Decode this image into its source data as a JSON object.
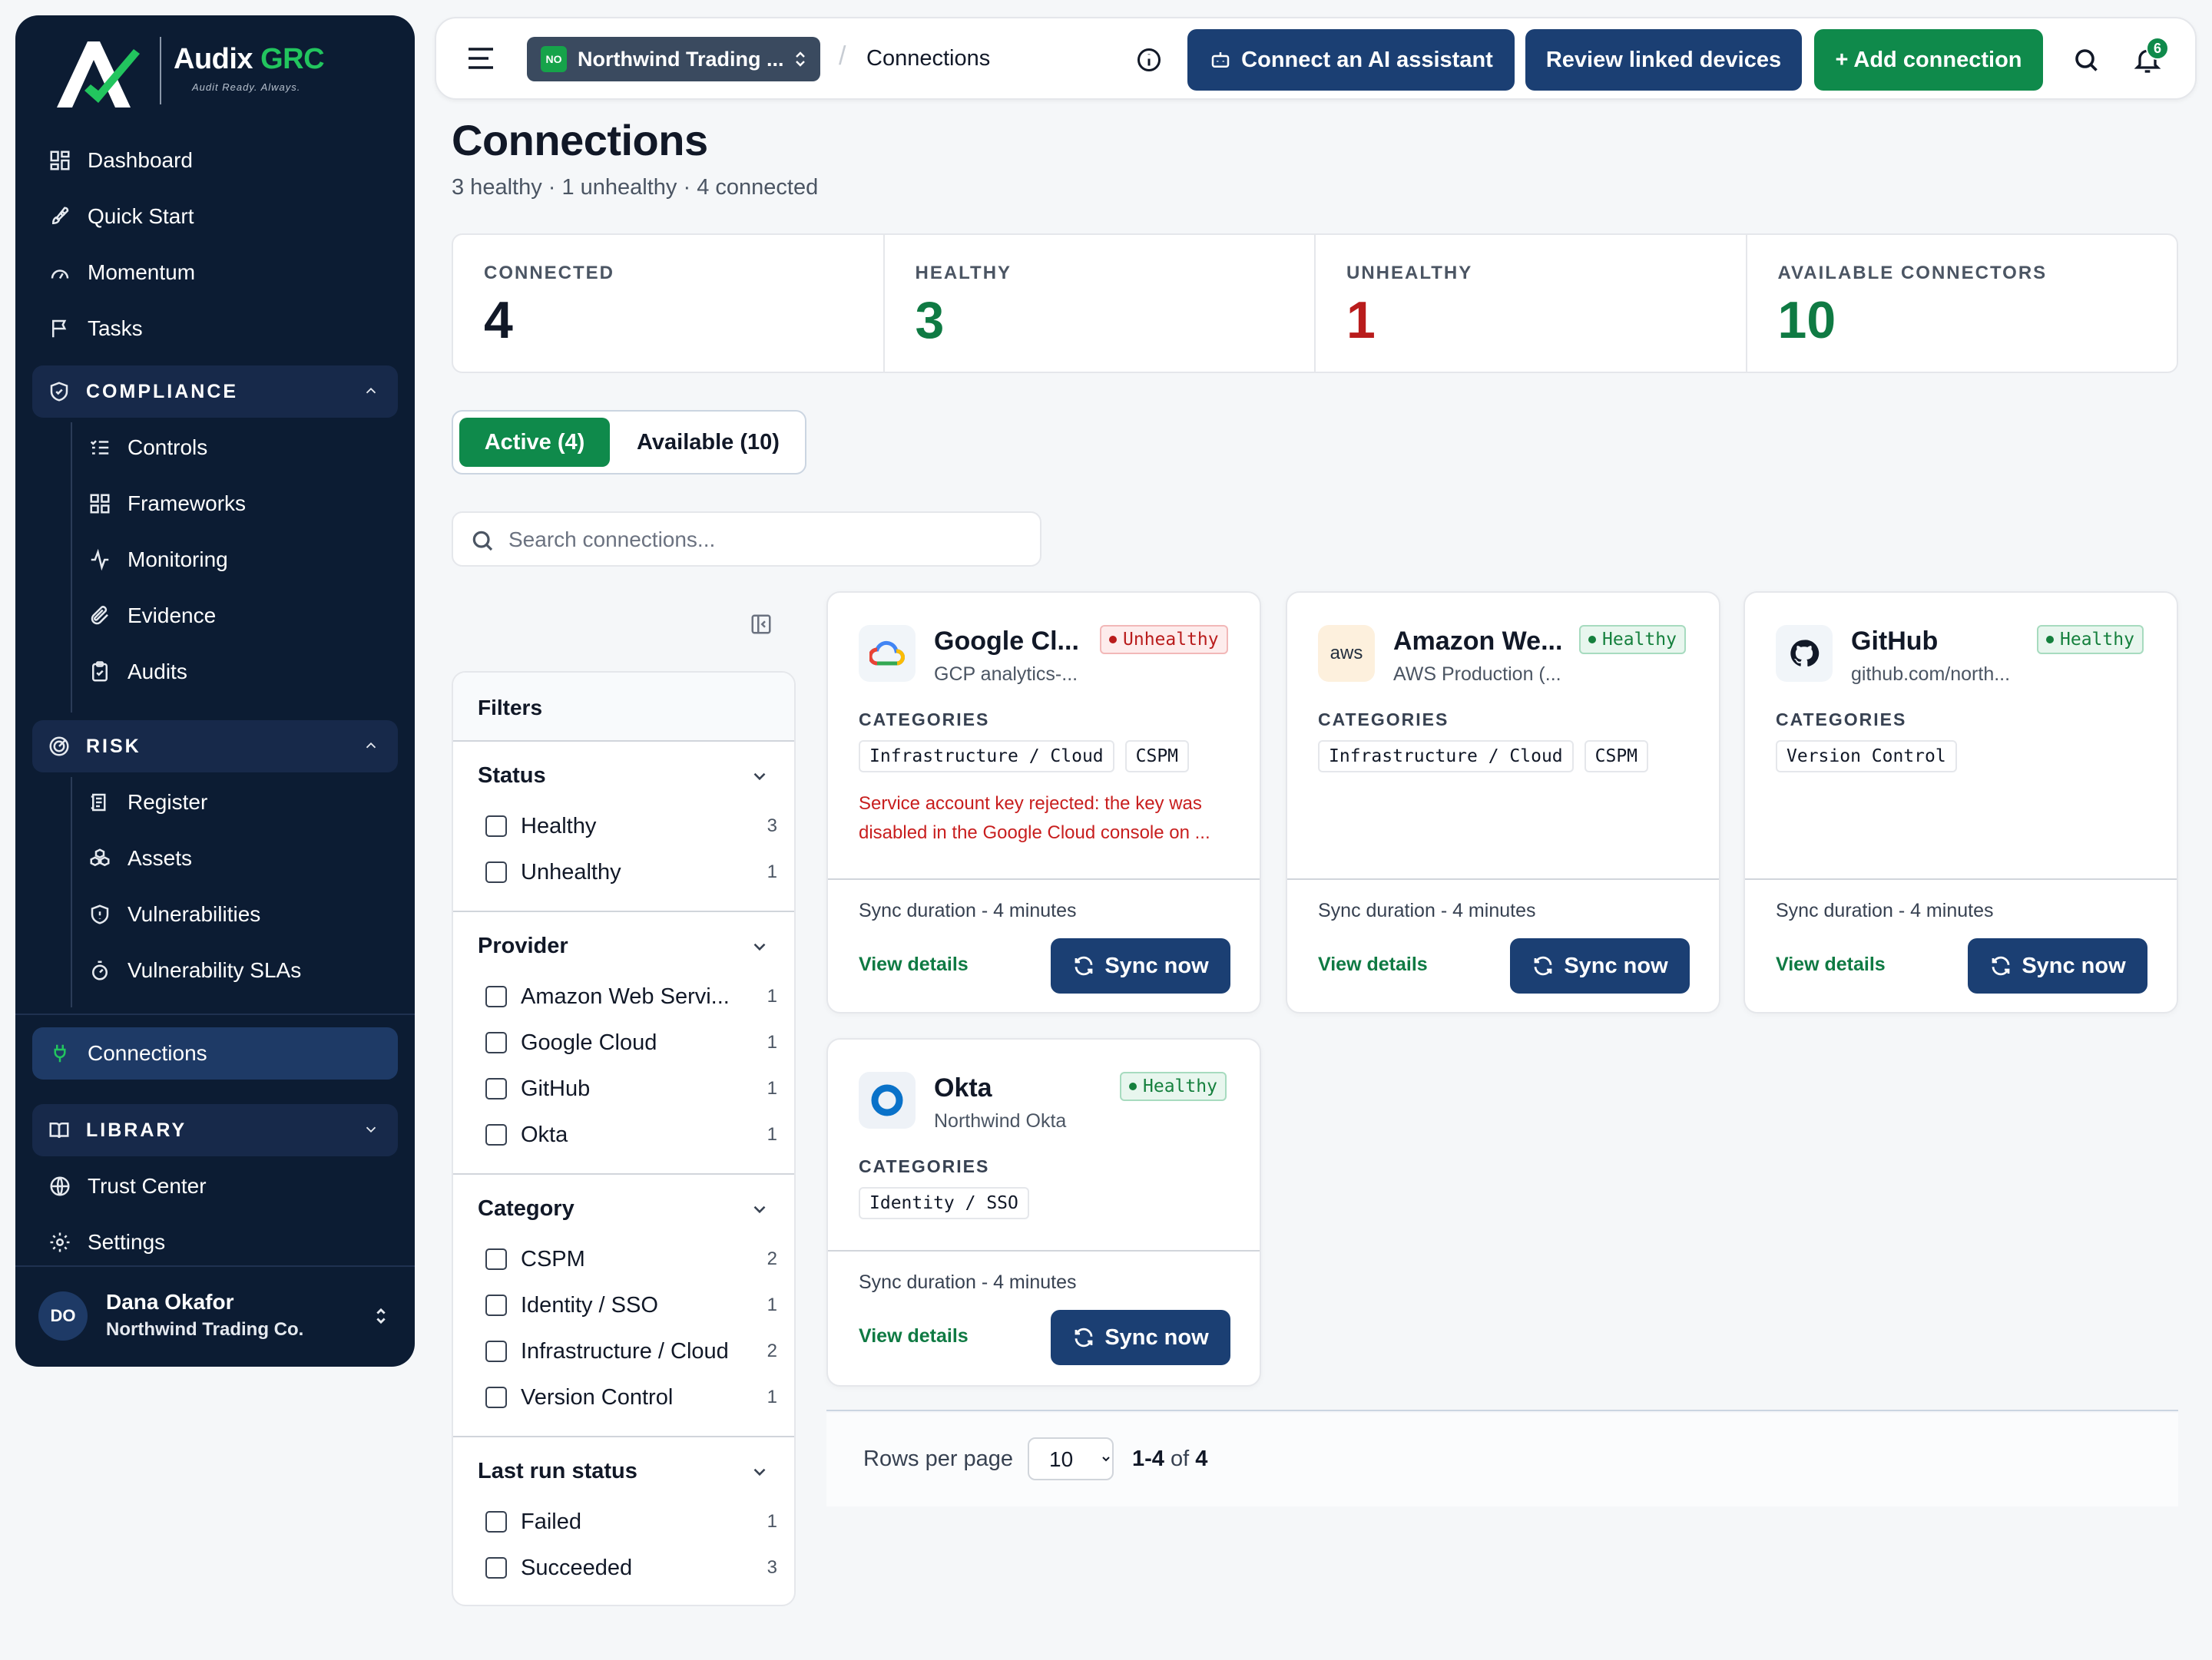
{
  "brand": {
    "name_main": "Audix",
    "name_accent": "GRC",
    "tagline": "Audit Ready. Always."
  },
  "sidebar": {
    "top_items": [
      {
        "label": "Dashboard",
        "icon": "dashboard-icon"
      },
      {
        "label": "Quick Start",
        "icon": "rocket-icon"
      },
      {
        "label": "Momentum",
        "icon": "gauge-icon"
      },
      {
        "label": "Tasks",
        "icon": "flag-icon"
      }
    ],
    "compliance": {
      "title": "COMPLIANCE",
      "items": [
        {
          "label": "Controls",
          "icon": "list-check-icon"
        },
        {
          "label": "Frameworks",
          "icon": "grid-icon"
        },
        {
          "label": "Monitoring",
          "icon": "activity-icon"
        },
        {
          "label": "Evidence",
          "icon": "paperclip-icon"
        },
        {
          "label": "Audits",
          "icon": "clipboard-icon"
        }
      ]
    },
    "risk": {
      "title": "RISK",
      "items": [
        {
          "label": "Register",
          "icon": "register-icon"
        },
        {
          "label": "Assets",
          "icon": "assets-icon"
        },
        {
          "label": "Vulnerabilities",
          "icon": "shield-icon"
        },
        {
          "label": "Vulnerability SLAs",
          "icon": "timer-icon"
        }
      ]
    },
    "connections": {
      "label": "Connections",
      "icon": "plug-icon"
    },
    "library": {
      "title": "LIBRARY"
    },
    "bottom_items": [
      {
        "label": "Trust Center",
        "icon": "globe-icon"
      },
      {
        "label": "Settings",
        "icon": "gear-icon"
      }
    ],
    "user": {
      "initials": "DO",
      "name": "Dana Okafor",
      "org": "Northwind Trading Co."
    }
  },
  "topbar": {
    "org_badge": "NO",
    "org_name": "Northwind Trading ...",
    "crumb_sep": "/",
    "crumb": "Connections",
    "btn_ai": "Connect an AI assistant",
    "btn_devices": "Review linked devices",
    "btn_add": "+ Add connection",
    "notif_count": "6"
  },
  "page": {
    "title": "Connections",
    "subtitle": "3 healthy · 1 unhealthy · 4 connected"
  },
  "stats": [
    {
      "label": "CONNECTED",
      "value": "4",
      "color": "#111827"
    },
    {
      "label": "HEALTHY",
      "value": "3",
      "color": "#0f7a43"
    },
    {
      "label": "UNHEALTHY",
      "value": "1",
      "color": "#b91c1c"
    },
    {
      "label": "AVAILABLE CONNECTORS",
      "value": "10",
      "color": "#0f7a43"
    }
  ],
  "tabs": {
    "active": "Active (4)",
    "available": "Available (10)"
  },
  "search": {
    "placeholder": "Search connections..."
  },
  "filters": {
    "title": "Filters",
    "groups": [
      {
        "title": "Status",
        "options": [
          {
            "label": "Healthy",
            "count": "3"
          },
          {
            "label": "Unhealthy",
            "count": "1"
          }
        ]
      },
      {
        "title": "Provider",
        "options": [
          {
            "label": "Amazon Web Servi...",
            "count": "1"
          },
          {
            "label": "Google Cloud",
            "count": "1"
          },
          {
            "label": "GitHub",
            "count": "1"
          },
          {
            "label": "Okta",
            "count": "1"
          }
        ]
      },
      {
        "title": "Category",
        "options": [
          {
            "label": "CSPM",
            "count": "2"
          },
          {
            "label": "Identity / SSO",
            "count": "1"
          },
          {
            "label": "Infrastructure / Cloud",
            "count": "2"
          },
          {
            "label": "Version Control",
            "count": "1"
          }
        ]
      },
      {
        "title": "Last run status",
        "options": [
          {
            "label": "Failed",
            "count": "1"
          },
          {
            "label": "Succeeded",
            "count": "3"
          }
        ]
      }
    ]
  },
  "cards": [
    {
      "title": "Google Cl...",
      "subtitle": "GCP analytics-...",
      "status": "Unhealthy",
      "logo": "google-cloud-icon",
      "categories_label": "CATEGORIES",
      "chips": [
        "Infrastructure / Cloud",
        "CSPM"
      ],
      "error": "Service account key rejected: the key was disabled in the Google Cloud console on ...",
      "sync": "Sync duration - 4 minutes",
      "view": "View details",
      "btn": "Sync now"
    },
    {
      "title": "Amazon We...",
      "subtitle": "AWS Production (...",
      "status": "Healthy",
      "logo": "aws-icon",
      "logo_text": "aws",
      "categories_label": "CATEGORIES",
      "chips": [
        "Infrastructure / Cloud",
        "CSPM"
      ],
      "sync": "Sync duration - 4 minutes",
      "view": "View details",
      "btn": "Sync now"
    },
    {
      "title": "GitHub",
      "subtitle": "github.com/north...",
      "status": "Healthy",
      "logo": "github-icon",
      "categories_label": "CATEGORIES",
      "chips": [
        "Version Control"
      ],
      "sync": "Sync duration - 4 minutes",
      "view": "View details",
      "btn": "Sync now"
    },
    {
      "title": "Okta",
      "subtitle": "Northwind Okta",
      "status": "Healthy",
      "logo": "okta-icon",
      "categories_label": "CATEGORIES",
      "chips": [
        "Identity / SSO"
      ],
      "sync": "Sync duration - 4 minutes",
      "view": "View details",
      "btn": "Sync now"
    }
  ],
  "pagination": {
    "rows_label": "Rows per page",
    "rows_value": "10",
    "range": "1-4",
    "of": "of",
    "total": "4"
  }
}
